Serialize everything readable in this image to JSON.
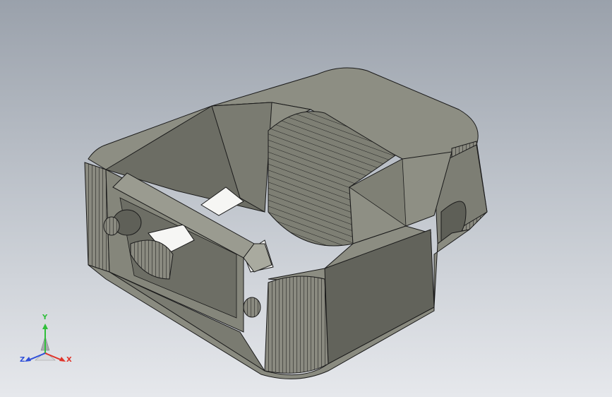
{
  "viewport": {
    "background_top": "#9aa1ab",
    "background_bottom": "#e6e8ec",
    "model_face_color": "#8e8e82",
    "model_edge_color": "#1a1a1a",
    "model_name": ""
  },
  "triad": {
    "x_label": "X",
    "y_label": "Y",
    "z_label": "Z",
    "x_color": "#e0342a",
    "y_color": "#2fbf3a",
    "z_color": "#2f4fd9"
  }
}
